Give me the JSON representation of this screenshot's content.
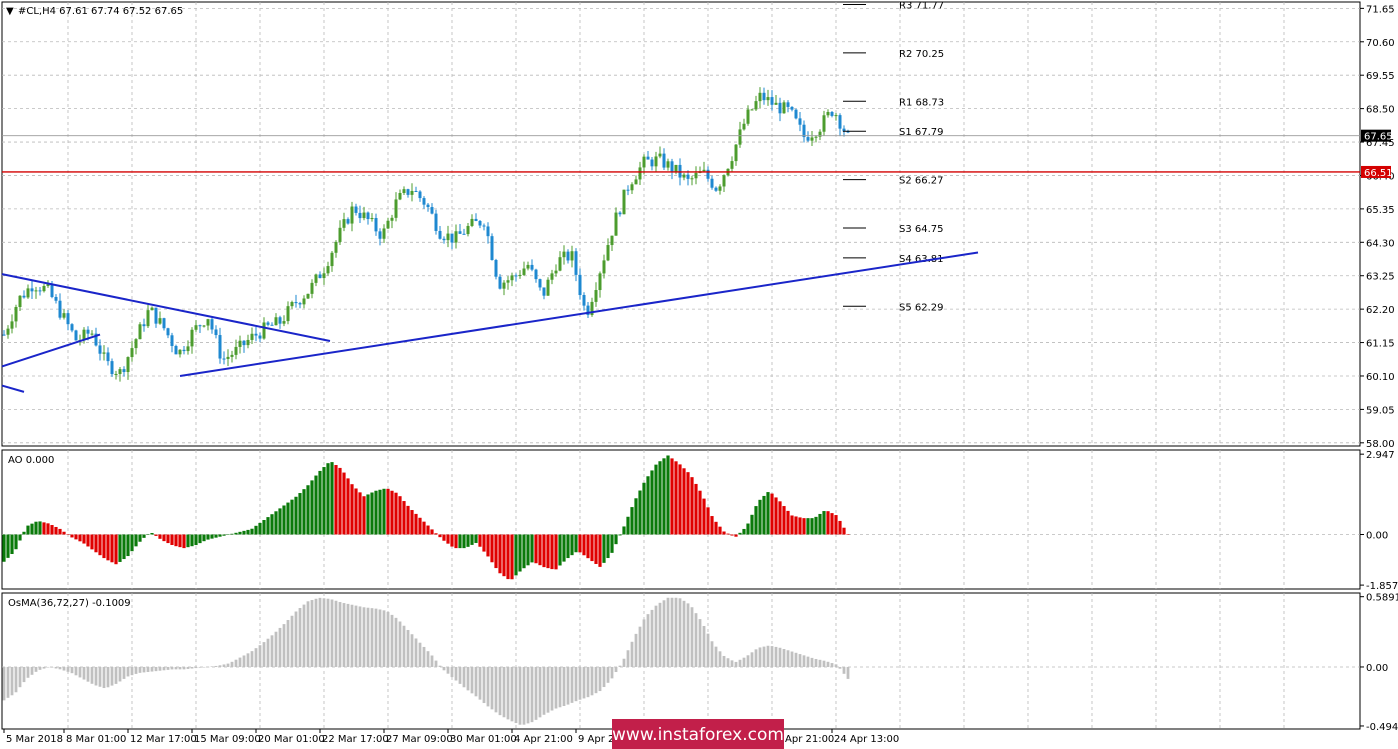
{
  "header": {
    "symbol_line": "#CL,H4  67.61 67.74 67.52 67.65",
    "ao_label": "AO 0.000",
    "osma_label": "OsMA(36,72,27) -0.1009"
  },
  "watermark": "www.instaforex.com",
  "colors": {
    "bull": "#4c9c2e",
    "bear": "#1e88d0",
    "ao_up": "#0a7a0a",
    "ao_down": "#e00000",
    "osma": "#c0c0c0",
    "trendline": "#1a25c9",
    "support_line": "#d40000",
    "grid": "#b9b9b9"
  },
  "chart_data": [
    {
      "type": "candlestick",
      "panel": "price",
      "yticks": [
        "71.65",
        "70.60",
        "69.55",
        "68.50",
        "67.45",
        "66.40",
        "65.35",
        "64.30",
        "63.25",
        "62.20",
        "61.15",
        "60.10",
        "59.05",
        "58.00"
      ],
      "ylim": [
        57.9,
        71.85
      ],
      "current_price": "67.65",
      "marked_level": "66.51",
      "pivot_levels": [
        {
          "label": "R3 71.77",
          "value": 71.77
        },
        {
          "label": "R2 70.25",
          "value": 70.25
        },
        {
          "label": "R1 68.73",
          "value": 68.73
        },
        {
          "label": "S1 67.79",
          "value": 67.79
        },
        {
          "label": "S2 66.27",
          "value": 66.27
        },
        {
          "label": "S3 64.75",
          "value": 64.75
        },
        {
          "label": "S4 63.81",
          "value": 63.81
        },
        {
          "label": "S5 62.29",
          "value": 62.29
        }
      ],
      "price_path": [
        61.4,
        62.5,
        63.0,
        62.8,
        62.0,
        61.2,
        61.5,
        60.5,
        60.2,
        61.2,
        62.2,
        61.6,
        60.8,
        61.5,
        62.0,
        60.6,
        60.9,
        61.3,
        61.6,
        61.8,
        62.4,
        62.8,
        63.5,
        64.5,
        65.4,
        65.0,
        64.5,
        65.6,
        66.0,
        65.5,
        64.6,
        64.4,
        64.8,
        65.0,
        63.0,
        63.2,
        63.6,
        62.6,
        63.7,
        63.9,
        62.0,
        63.5,
        65.0,
        66.2,
        66.8,
        66.9,
        66.6,
        66.2,
        66.5,
        66.0,
        67.0,
        68.2,
        68.9,
        68.6,
        68.4,
        67.6,
        67.9,
        68.5,
        67.6
      ],
      "trendlines": [
        {
          "name": "upper-falling",
          "from": [
            2,
            63.3
          ],
          "to": [
            330,
            61.2
          ]
        },
        {
          "name": "main-support",
          "from": [
            180,
            60.1
          ],
          "to": [
            978,
            63.98
          ]
        },
        {
          "name": "short-support-1",
          "from": [
            2,
            60.4
          ],
          "to": [
            100,
            61.4
          ]
        },
        {
          "name": "short-support-2",
          "from": [
            2,
            59.8
          ],
          "to": [
            24,
            59.6
          ]
        }
      ],
      "xticks": [
        "5 Mar 2018",
        "8 Mar 01:00",
        "12 Mar 17:00",
        "15 Mar 09:00",
        "20 Mar 01:00",
        "22 Mar 17:00",
        "27 Mar 09:00",
        "30 Mar 01:00",
        "4 Apr 21:00",
        "9 Apr 21",
        "Apr 21:00",
        "24 Apr 13:00"
      ]
    },
    {
      "type": "histogram",
      "panel": "ao",
      "yticks": [
        "2.947",
        "0.00",
        "-1.857"
      ],
      "ylim": [
        -2.0,
        3.1
      ],
      "values": [
        -1.0,
        -0.6,
        0.3,
        0.5,
        0.4,
        0.2,
        -0.1,
        -0.3,
        -0.6,
        -0.9,
        -1.1,
        -0.8,
        -0.3,
        0.1,
        -0.2,
        -0.4,
        -0.5,
        -0.4,
        -0.2,
        -0.1,
        0.0,
        0.1,
        0.2,
        0.5,
        0.8,
        1.1,
        1.4,
        1.8,
        2.3,
        2.7,
        2.4,
        1.8,
        1.4,
        1.6,
        1.7,
        1.5,
        1.0,
        0.6,
        0.2,
        -0.2,
        -0.5,
        -0.5,
        -0.3,
        -0.8,
        -1.4,
        -1.7,
        -1.3,
        -1.0,
        -1.2,
        -1.3,
        -0.9,
        -0.6,
        -0.9,
        -1.2,
        -0.7,
        0.2,
        1.2,
        2.0,
        2.6,
        2.9,
        2.6,
        2.2,
        1.5,
        0.6,
        0.1,
        -0.1,
        0.3,
        1.2,
        1.6,
        1.2,
        0.7,
        0.6,
        0.6,
        0.9,
        0.7,
        0.0
      ],
      "colors_up": [
        false,
        true,
        true,
        true,
        false,
        false,
        false,
        false,
        false,
        false,
        false,
        true,
        true,
        true,
        false,
        false,
        false,
        true,
        true,
        true,
        true,
        true,
        true,
        true,
        true,
        true,
        true,
        true,
        true,
        true,
        false,
        false,
        false,
        true,
        true,
        false,
        false,
        false,
        false,
        false,
        false,
        false,
        true,
        false,
        false,
        false,
        true,
        true,
        false,
        false,
        true,
        true,
        false,
        false,
        true,
        true,
        true,
        true,
        true,
        true,
        false,
        false,
        false,
        false,
        false,
        false,
        true,
        true,
        true,
        false,
        false,
        false,
        true,
        true,
        false,
        false
      ]
    },
    {
      "type": "histogram",
      "panel": "osma",
      "yticks": [
        "0.5891",
        "0.00",
        "-0.4946"
      ],
      "ylim": [
        -0.52,
        0.62
      ],
      "values": [
        -0.28,
        -0.22,
        -0.1,
        -0.03,
        0.0,
        -0.02,
        -0.05,
        -0.1,
        -0.15,
        -0.18,
        -0.14,
        -0.08,
        -0.05,
        -0.04,
        -0.03,
        -0.02,
        -0.02,
        -0.01,
        0.0,
        0.01,
        0.03,
        0.08,
        0.13,
        0.2,
        0.28,
        0.37,
        0.47,
        0.55,
        0.58,
        0.57,
        0.54,
        0.52,
        0.5,
        0.49,
        0.47,
        0.4,
        0.3,
        0.2,
        0.1,
        -0.02,
        -0.1,
        -0.18,
        -0.25,
        -0.33,
        -0.4,
        -0.45,
        -0.49,
        -0.46,
        -0.4,
        -0.35,
        -0.32,
        -0.28,
        -0.25,
        -0.2,
        -0.1,
        0.05,
        0.25,
        0.42,
        0.52,
        0.58,
        0.58,
        0.52,
        0.38,
        0.2,
        0.09,
        0.04,
        0.09,
        0.16,
        0.18,
        0.16,
        0.13,
        0.1,
        0.07,
        0.05,
        0.02,
        -0.1
      ]
    }
  ]
}
